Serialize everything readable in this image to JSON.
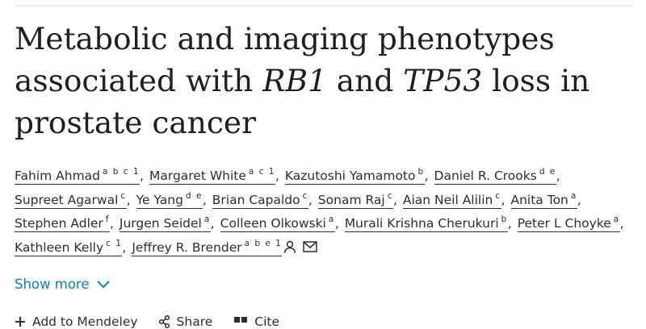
{
  "article": {
    "title_parts": [
      {
        "text": "Metabolic and imaging phenotypes associated with ",
        "italic": false
      },
      {
        "text": "RB1",
        "italic": true
      },
      {
        "text": " and ",
        "italic": false
      },
      {
        "text": "TP53",
        "italic": true
      },
      {
        "text": " loss in prostate cancer",
        "italic": false
      }
    ],
    "authors": [
      {
        "name": "Fahim Ahmad",
        "sup": "a b c 1"
      },
      {
        "name": "Margaret White",
        "sup": "a c 1"
      },
      {
        "name": "Kazutoshi Yamamoto",
        "sup": "b"
      },
      {
        "name": "Daniel R. Crooks",
        "sup": "d e"
      },
      {
        "name": "Supreet Agarwal",
        "sup": "c"
      },
      {
        "name": "Ye Yang",
        "sup": "d e"
      },
      {
        "name": "Brian Capaldo",
        "sup": "c"
      },
      {
        "name": "Sonam Raj",
        "sup": "c"
      },
      {
        "name": "Aian Neil Alilin",
        "sup": "c"
      },
      {
        "name": "Anita Ton",
        "sup": "a"
      },
      {
        "name": "Stephen Adler",
        "sup": "f"
      },
      {
        "name": "Jurgen Seidel",
        "sup": "a"
      },
      {
        "name": "Colleen Olkowski",
        "sup": "a"
      },
      {
        "name": "Murali Krishna Cherukuri",
        "sup": "b"
      },
      {
        "name": "Peter L Choyke",
        "sup": "a"
      },
      {
        "name": "Kathleen Kelly",
        "sup": "c 1"
      },
      {
        "name": "Jeffrey R. Brender",
        "sup": "a b e 1"
      }
    ],
    "author_separator": ",",
    "corresponding_icons": [
      "person-icon",
      "envelope-icon"
    ],
    "show_more_label": "Show more",
    "actions": [
      {
        "label": "Add to Mendeley",
        "icon": "plus-icon"
      },
      {
        "label": "Share",
        "icon": "share-icon"
      },
      {
        "label": "Cite",
        "icon": "quote-icon"
      }
    ]
  },
  "colors": {
    "text": "#1f1f1f",
    "link_accent": "#0c7dbb",
    "rule": "#e9e9e9"
  }
}
